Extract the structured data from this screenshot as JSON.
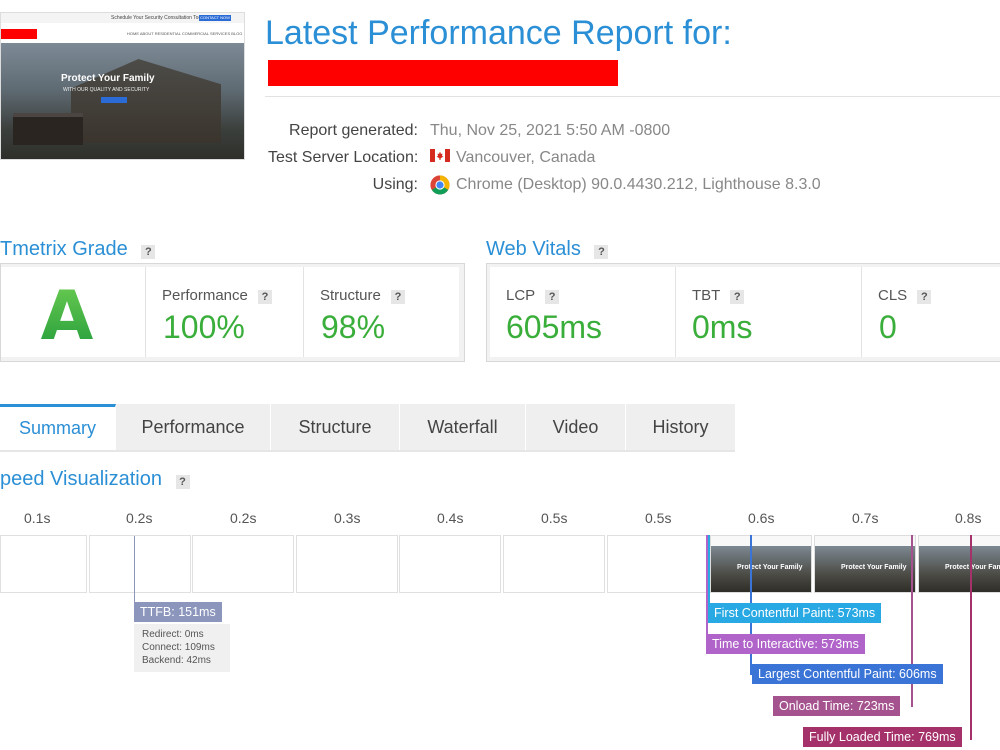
{
  "header": {
    "title": "Latest Performance Report for:",
    "thumbnail": {
      "topbar_text": "Schedule Your Security Consultation Today",
      "topbar_button": "CONTACT NOW",
      "nav": "HOME   ABOUT   RESIDENTIAL   COMMERCIAL   SERVICES   BLOG",
      "hero_title": "Protect Your Family",
      "hero_subtitle": "WITH OUR QUALITY AND SECURITY"
    }
  },
  "report_meta": {
    "generated_label": "Report generated:",
    "generated_value": "Thu, Nov 25, 2021 5:50 AM -0800",
    "location_label": "Test Server Location:",
    "location_value": "Vancouver, Canada",
    "using_label": "Using:",
    "using_value": "Chrome (Desktop) 90.0.4430.212, Lighthouse 8.3.0"
  },
  "grade": {
    "section_title": "Tmetrix Grade",
    "help": "?",
    "letter": "A",
    "performance_label": "Performance",
    "performance_value": "100%",
    "structure_label": "Structure",
    "structure_value": "98%"
  },
  "web_vitals": {
    "section_title": "Web Vitals",
    "help": "?",
    "lcp_label": "LCP",
    "lcp_value": "605ms",
    "tbt_label": "TBT",
    "tbt_value": "0ms",
    "cls_label": "CLS",
    "cls_value": "0"
  },
  "tabs": [
    "Summary",
    "Performance",
    "Structure",
    "Waterfall",
    "Video",
    "History"
  ],
  "speed_viz": {
    "title": "peed Visualization",
    "help": "?",
    "ticks": [
      "0.1s",
      "0.2s",
      "0.2s",
      "0.3s",
      "0.4s",
      "0.5s",
      "0.5s",
      "0.6s",
      "0.7s",
      "0.8s"
    ],
    "screenshot_text": "Protect Your Family",
    "ttfb": {
      "label": "TTFB: 151ms",
      "redirect": "Redirect: 0ms",
      "connect": "Connect: 109ms",
      "backend": "Backend: 42ms"
    },
    "markers": {
      "fcp": "First Contentful Paint: 573ms",
      "tti": "Time to Interactive: 573ms",
      "lcp": "Largest Contentful Paint: 606ms",
      "onload": "Onload Time: 723ms",
      "fully": "Fully Loaded Time: 769ms"
    },
    "colors": {
      "ttfb": "#8c96bd",
      "fcp": "#29a9e3",
      "tti": "#b063c8",
      "lcp": "#3a74d6",
      "onload": "#a5538e",
      "fully": "#a4316a"
    }
  },
  "colors": {
    "accent": "#2b8fd6",
    "grade_green": "#3aae3a",
    "redaction": "#ff0000"
  }
}
